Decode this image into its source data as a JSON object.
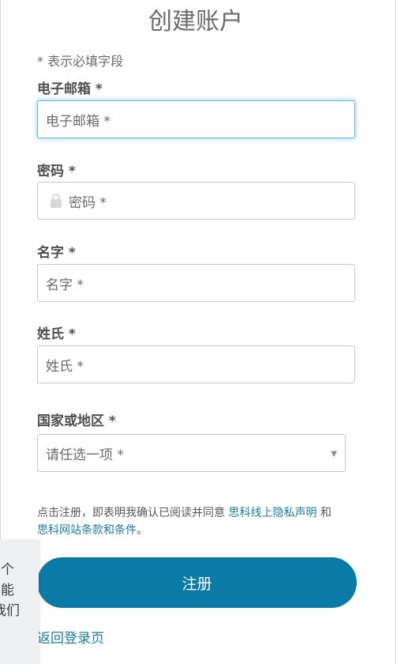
{
  "title": "创建账户",
  "required_note": "* 表示必填字段",
  "fields": {
    "email": {
      "label": "电子邮箱 *",
      "placeholder": "电子邮箱 *"
    },
    "password": {
      "label": "密码 *",
      "placeholder": "密码 *",
      "icon": "lock-icon"
    },
    "first_name": {
      "label": "名字 *",
      "placeholder": "名字 *"
    },
    "last_name": {
      "label": "姓氏 *",
      "placeholder": "姓氏 *"
    },
    "country": {
      "label": "国家或地区 *",
      "placeholder": "请任选一项 *",
      "icon": "chevron-down-icon"
    }
  },
  "legal": {
    "prefix": "点击注册，即表明我确认已阅读并同意",
    "privacy_link": "思科线上隐私声明",
    "conjunction": "和",
    "terms_link": "思科网站条款和条件",
    "suffix": "。"
  },
  "register_button": "注册",
  "back_link": "返回登录页",
  "side_panel": {
    "lines": [
      "个",
      "能",
      "我们"
    ]
  },
  "colors": {
    "accent": "#0a7aa6",
    "link": "#1b7da3",
    "focus": "#64b5e8"
  }
}
